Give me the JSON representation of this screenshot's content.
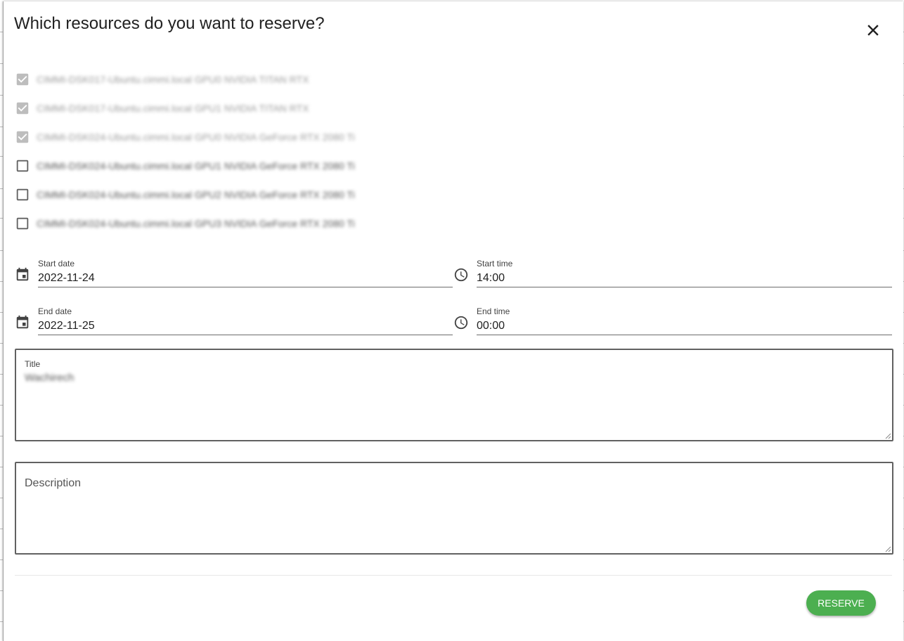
{
  "dialog": {
    "title": "Which resources do you want to reserve?"
  },
  "resources": [
    {
      "label": "CIMMI-DSK017-Ubuntu.cimmi.local GPU0 NVIDIA TITAN RTX",
      "checked": true,
      "disabled": true
    },
    {
      "label": "CIMMI-DSK017-Ubuntu.cimmi.local GPU1 NVIDIA TITAN RTX",
      "checked": true,
      "disabled": true
    },
    {
      "label": "CIMMI-DSK024-Ubuntu.cimmi.local GPU0 NVIDIA GeForce RTX 2080 Ti",
      "checked": true,
      "disabled": true
    },
    {
      "label": "CIMMI-DSK024-Ubuntu.cimmi.local GPU1 NVIDIA GeForce RTX 2080 Ti",
      "checked": false,
      "disabled": false
    },
    {
      "label": "CIMMI-DSK024-Ubuntu.cimmi.local GPU2 NVIDIA GeForce RTX 2080 Ti",
      "checked": false,
      "disabled": false
    },
    {
      "label": "CIMMI-DSK024-Ubuntu.cimmi.local GPU3 NVIDIA GeForce RTX 2080 Ti",
      "checked": false,
      "disabled": false
    }
  ],
  "start_date": {
    "label": "Start date",
    "value": "2022-11-24"
  },
  "start_time": {
    "label": "Start time",
    "value": "14:00"
  },
  "end_date": {
    "label": "End date",
    "value": "2022-11-25"
  },
  "end_time": {
    "label": "End time",
    "value": "00:00"
  },
  "title_field": {
    "label": "Title",
    "value": "Wachirech"
  },
  "description_field": {
    "label": "Description",
    "value": ""
  },
  "reserve_label": "Reserve",
  "icons": {
    "close": "close-icon",
    "calendar": "calendar-icon",
    "clock": "clock-icon",
    "checkbox_checked": "checkbox-checked-icon",
    "checkbox_unchecked": "checkbox-unchecked-icon"
  },
  "colors": {
    "accent": "#4caf50",
    "checkbox_disabled": "#bdbdbd",
    "checkbox_enabled": "#616161"
  }
}
